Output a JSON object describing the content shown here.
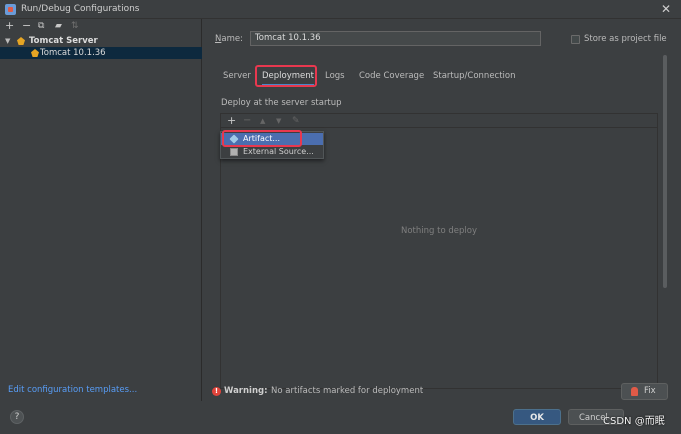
{
  "window": {
    "title": "Run/Debug Configurations",
    "close_glyph": "✕"
  },
  "left_toolbar": {
    "add": "+",
    "remove": "−",
    "copy": "⧉",
    "folder": "▰",
    "sort": "⇅"
  },
  "tree": {
    "parent_label": "Tomcat Server",
    "child_label": "Tomcat 10.1.36"
  },
  "edit_templates_link": "Edit configuration templates...",
  "form": {
    "name_label_prefix": "N",
    "name_label_rest": "ame:",
    "name_value": "Tomcat 10.1.36",
    "store_label": "Store as project file",
    "store_checked": false
  },
  "tabs": [
    {
      "label": "Server"
    },
    {
      "label": "Deployment"
    },
    {
      "label": "Logs"
    },
    {
      "label": "Code Coverage"
    },
    {
      "label": "Startup/Connection"
    }
  ],
  "deployment": {
    "caption": "Deploy at the server startup",
    "empty_text": "Nothing to deploy",
    "toolbar": {
      "add": "+",
      "remove": "−",
      "up": "▲",
      "down": "▼",
      "edit": "✎"
    },
    "popup": {
      "artifact": "Artifact...",
      "external": "External Source..."
    }
  },
  "warning": {
    "icon": "!",
    "strong": "Warning:",
    "text": "No artifacts marked for deployment"
  },
  "buttons": {
    "fix": "Fix",
    "ok": "OK",
    "cancel": "Cancel",
    "help": "?"
  },
  "watermark": "CSDN @而眠",
  "colors": {
    "background": "#3c3f41",
    "selection": "#0d293e",
    "popup_selection": "#4b6eaf",
    "ok_button": "#365880",
    "link": "#589df6",
    "highlight_box": "#e8384f",
    "warning_icon": "#e0443b"
  }
}
